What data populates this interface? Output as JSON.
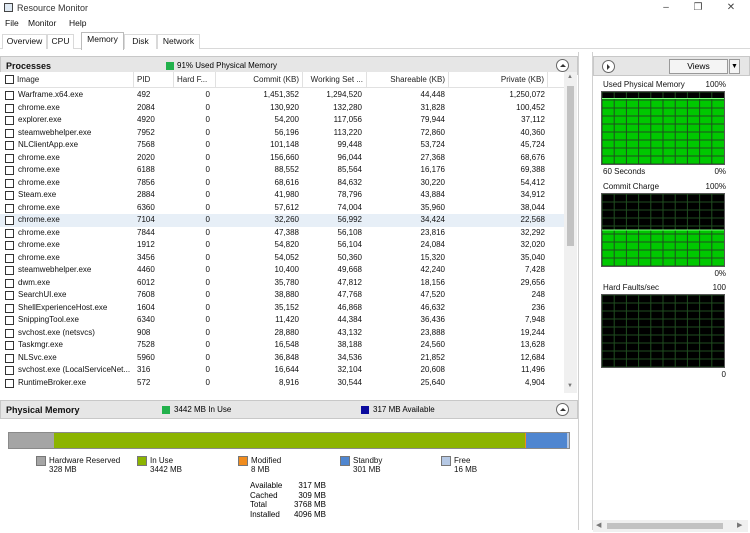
{
  "window": {
    "title": "Resource Monitor"
  },
  "menu": [
    "File",
    "Monitor",
    "Help"
  ],
  "tabs": [
    "Overview",
    "CPU",
    "Memory",
    "Disk",
    "Network"
  ],
  "active_tab": "Memory",
  "processes": {
    "title": "Processes",
    "summary": "91% Used Physical Memory",
    "summary_color": "#22b14c",
    "columns": [
      "Image",
      "PID",
      "Hard F...",
      "Commit (KB)",
      "Working Set ...",
      "Shareable (KB)",
      "Private (KB)"
    ],
    "rows": [
      [
        "Warframe.x64.exe",
        "492",
        "0",
        "1,451,352",
        "1,294,520",
        "44,448",
        "1,250,072"
      ],
      [
        "chrome.exe",
        "2084",
        "0",
        "130,920",
        "132,280",
        "31,828",
        "100,452"
      ],
      [
        "explorer.exe",
        "4920",
        "0",
        "54,200",
        "117,056",
        "79,944",
        "37,112"
      ],
      [
        "steamwebhelper.exe",
        "7952",
        "0",
        "56,196",
        "113,220",
        "72,860",
        "40,360"
      ],
      [
        "NLClientApp.exe",
        "7568",
        "0",
        "101,148",
        "99,448",
        "53,724",
        "45,724"
      ],
      [
        "chrome.exe",
        "2020",
        "0",
        "156,660",
        "96,044",
        "27,368",
        "68,676"
      ],
      [
        "chrome.exe",
        "6188",
        "0",
        "88,552",
        "85,564",
        "16,176",
        "69,388"
      ],
      [
        "chrome.exe",
        "7856",
        "0",
        "68,616",
        "84,632",
        "30,220",
        "54,412"
      ],
      [
        "Steam.exe",
        "2884",
        "0",
        "41,980",
        "78,796",
        "43,884",
        "34,912"
      ],
      [
        "chrome.exe",
        "6360",
        "0",
        "57,612",
        "74,004",
        "35,960",
        "38,044"
      ],
      [
        "chrome.exe",
        "7104",
        "0",
        "32,260",
        "56,992",
        "34,424",
        "22,568"
      ],
      [
        "chrome.exe",
        "7844",
        "0",
        "47,388",
        "56,108",
        "23,816",
        "32,292"
      ],
      [
        "chrome.exe",
        "1912",
        "0",
        "54,820",
        "56,104",
        "24,084",
        "32,020"
      ],
      [
        "chrome.exe",
        "3456",
        "0",
        "54,052",
        "50,360",
        "15,320",
        "35,040"
      ],
      [
        "steamwebhelper.exe",
        "4460",
        "0",
        "10,400",
        "49,668",
        "42,240",
        "7,428"
      ],
      [
        "dwm.exe",
        "6012",
        "0",
        "35,780",
        "47,812",
        "18,156",
        "29,656"
      ],
      [
        "SearchUI.exe",
        "7608",
        "0",
        "38,880",
        "47,768",
        "47,520",
        "248"
      ],
      [
        "ShellExperienceHost.exe",
        "1604",
        "0",
        "35,152",
        "46,868",
        "46,632",
        "236"
      ],
      [
        "SnippingTool.exe",
        "6340",
        "0",
        "11,420",
        "44,384",
        "36,436",
        "7,948"
      ],
      [
        "svchost.exe (netsvcs)",
        "908",
        "0",
        "28,880",
        "43,132",
        "23,888",
        "19,244"
      ],
      [
        "Taskmgr.exe",
        "7528",
        "0",
        "16,548",
        "38,188",
        "24,560",
        "13,628"
      ],
      [
        "NLSvc.exe",
        "5960",
        "0",
        "36,848",
        "34,536",
        "21,852",
        "12,684"
      ],
      [
        "svchost.exe (LocalServiceNet...",
        "316",
        "0",
        "16,644",
        "32,104",
        "20,608",
        "11,496"
      ],
      [
        "RuntimeBroker.exe",
        "572",
        "0",
        "8,916",
        "30,544",
        "25,640",
        "4,904"
      ]
    ],
    "selected_row": 10
  },
  "physical_memory": {
    "title": "Physical Memory",
    "in_use_summary": "3442 MB In Use",
    "in_use_color": "#22b14c",
    "available_summary": "317 MB Available",
    "available_color": "#0a0a9e",
    "bar_segments": [
      {
        "name": "Hardware Reserved",
        "mb": 328,
        "color": "#a5a5a5"
      },
      {
        "name": "In Use",
        "mb": 3442,
        "color": "#8cb400"
      },
      {
        "name": "Modified",
        "mb": 8,
        "color": "#f08c1e"
      },
      {
        "name": "Standby",
        "mb": 301,
        "color": "#4f86d0"
      },
      {
        "name": "Free",
        "mb": 16,
        "color": "#b5c8e4"
      }
    ],
    "legend": [
      {
        "label": "Hardware Reserved",
        "value": "328 MB",
        "color": "#a5a5a5"
      },
      {
        "label": "In Use",
        "value": "3442 MB",
        "color": "#8cb400"
      },
      {
        "label": "Modified",
        "value": "8 MB",
        "color": "#f08c1e"
      },
      {
        "label": "Standby",
        "value": "301 MB",
        "color": "#4f86d0"
      },
      {
        "label": "Free",
        "value": "16 MB",
        "color": "#b5c8e4"
      }
    ],
    "stats": [
      {
        "label": "Available",
        "value": "317 MB"
      },
      {
        "label": "Cached",
        "value": "309 MB"
      },
      {
        "label": "Total",
        "value": "3768 MB"
      },
      {
        "label": "Installed",
        "value": "4096 MB"
      }
    ]
  },
  "side": {
    "views_label": "Views",
    "graphs": [
      {
        "title": "Used Physical Memory",
        "max": "100%",
        "footer_left": "60 Seconds",
        "footer_right": "0%",
        "level_pct": 91
      },
      {
        "title": "Commit Charge",
        "max": "100%",
        "footer_left": "",
        "footer_right": "0%",
        "level_pct": 50
      },
      {
        "title": "Hard Faults/sec",
        "max": "100",
        "footer_left": "",
        "footer_right": "0",
        "level_pct": 0
      }
    ],
    "graph_color": "#00c800"
  }
}
